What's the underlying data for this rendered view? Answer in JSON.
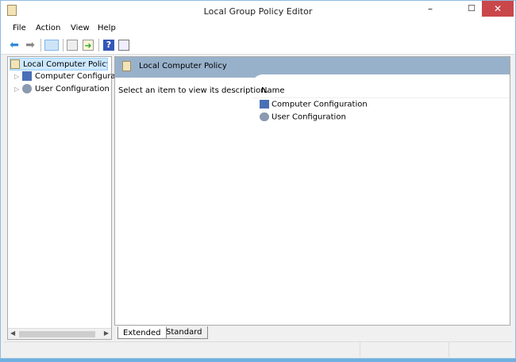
{
  "window": {
    "title": "Local Group Policy Editor",
    "minimize": "–",
    "maximize": "☐",
    "close": "✕"
  },
  "menu": [
    "File",
    "Action",
    "View",
    "Help"
  ],
  "toolbar": {
    "back": "back-icon",
    "forward": "forward-icon",
    "show_hide_tree": "console-tree-icon",
    "properties": "properties-icon",
    "export": "export-list-icon",
    "help": "?",
    "action_pane": "action-pane-icon"
  },
  "tree": {
    "root": "Local Computer Policy",
    "children": [
      "Computer Configuration",
      "User Configuration"
    ]
  },
  "detail": {
    "header": "Local Computer Policy",
    "description": "Select an item to view its description.",
    "column": "Name",
    "items": [
      "Computer Configuration",
      "User Configuration"
    ]
  },
  "tabs": [
    "Extended",
    "Standard"
  ]
}
